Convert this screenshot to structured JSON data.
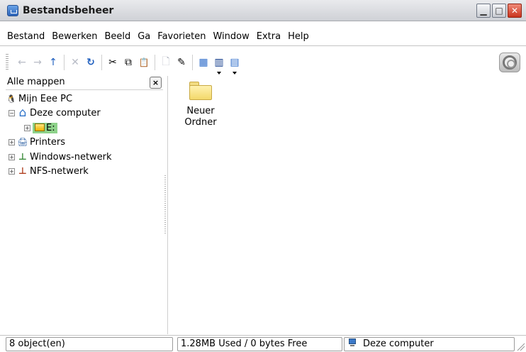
{
  "window": {
    "title": "Bestandsbeheer"
  },
  "menu": [
    {
      "label": "Bestand"
    },
    {
      "label": "Bewerken"
    },
    {
      "label": "Beeld"
    },
    {
      "label": "Ga"
    },
    {
      "label": "Favorieten"
    },
    {
      "label": "Window"
    },
    {
      "label": "Extra"
    },
    {
      "label": "Help"
    }
  ],
  "toolbar": {
    "buttons": [
      {
        "icon": "back-arrow-icon",
        "glyph": "←",
        "enabled": false
      },
      {
        "icon": "forward-arrow-icon",
        "glyph": "→",
        "enabled": false
      },
      {
        "icon": "up-arrow-icon",
        "glyph": "↑",
        "enabled": true
      },
      {
        "icon": "stop-icon",
        "glyph": "✕",
        "enabled": false
      },
      {
        "icon": "reload-icon",
        "glyph": "↻",
        "enabled": true
      },
      {
        "icon": "cut-icon",
        "glyph": "✂",
        "enabled": true
      },
      {
        "icon": "copy-icon",
        "glyph": "⧉",
        "enabled": true
      },
      {
        "icon": "paste-icon",
        "glyph": "📋",
        "enabled": false
      },
      {
        "icon": "delete-icon",
        "glyph": "🗋",
        "enabled": false
      },
      {
        "icon": "properties-icon",
        "glyph": "✎",
        "enabled": true
      },
      {
        "icon": "icon-view-icon",
        "glyph": "▦",
        "enabled": true
      },
      {
        "icon": "split-view-icon",
        "glyph": "▥",
        "enabled": true
      },
      {
        "icon": "detail-view-icon",
        "glyph": "▤",
        "enabled": true
      }
    ]
  },
  "sidebar": {
    "title": "Alle mappen",
    "close_glyph": "×",
    "tree": [
      {
        "label": "Mijn Eee PC",
        "icon": "tux-icon",
        "glyph": "🐧",
        "level": 0,
        "expander": ""
      },
      {
        "label": "Deze computer",
        "icon": "home-icon",
        "glyph": "⌂",
        "level": 1,
        "expander": "−"
      },
      {
        "label": "E:",
        "icon": "drive-icon",
        "glyph": "▭",
        "level": 2,
        "expander": "+",
        "selected": true
      },
      {
        "label": "Printers",
        "icon": "printer-icon",
        "glyph": "🖨",
        "level": 1,
        "expander": "+"
      },
      {
        "label": "Windows-netwerk",
        "icon": "network-icon",
        "glyph": "⊥",
        "level": 1,
        "expander": "+"
      },
      {
        "label": "NFS-netwerk",
        "icon": "network-icon",
        "glyph": "⊥",
        "level": 1,
        "expander": "+"
      }
    ]
  },
  "main": {
    "items": [
      {
        "label_line1": "Neuer",
        "label_line2": "Ordner",
        "icon": "folder-icon"
      }
    ]
  },
  "status": {
    "objects": "8 object(en)",
    "space": "1.28MB Used / 0 bytes Free",
    "location": "Deze computer",
    "location_icon": "computer-icon"
  },
  "colors": {
    "selection": "#8ed28a",
    "folder": "#f3d86a"
  }
}
